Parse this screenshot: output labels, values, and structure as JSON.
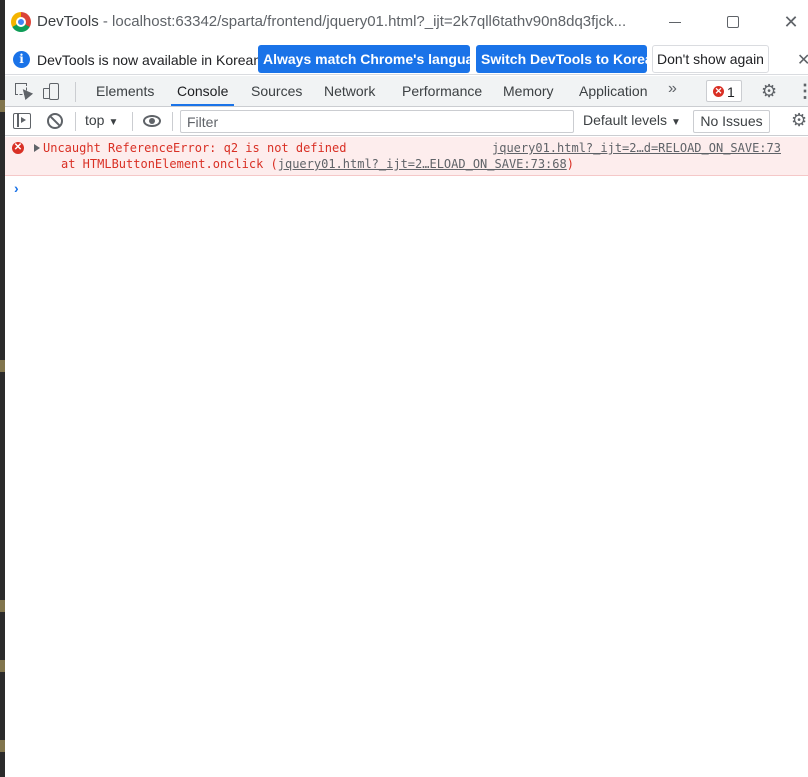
{
  "titlebar": {
    "app_name": "DevTools",
    "separator": " - ",
    "url": "localhost:63342/sparta/frontend/jquery01.html?_ijt=2k7qll6tathv90n8dq3fjck..."
  },
  "infobar": {
    "message": "DevTools is now available in Korean!",
    "match_language_label": "Always match Chrome's language",
    "switch_label": "Switch DevTools to Korean",
    "dismiss_label": "Don't show again"
  },
  "tabs": [
    {
      "label": "Elements"
    },
    {
      "label": "Console"
    },
    {
      "label": "Sources"
    },
    {
      "label": "Network"
    },
    {
      "label": "Performance"
    },
    {
      "label": "Memory"
    },
    {
      "label": "Application"
    }
  ],
  "active_tab": "Console",
  "more_tabs_glyph": "»",
  "error_count": "1",
  "console_toolbar": {
    "context": "top",
    "filter_placeholder": "Filter",
    "levels": "Default levels",
    "issues": "No Issues"
  },
  "messages": [
    {
      "level": "error",
      "text": "Uncaught ReferenceError: q2 is not defined",
      "source": "jquery01.html?_ijt=2…d=RELOAD_ON_SAVE:73",
      "stack_prefix": "at HTMLButtonElement.onclick (",
      "stack_link": "jquery01.html?_ijt=2…ELOAD_ON_SAVE:73:68",
      "stack_suffix": ")"
    }
  ],
  "prompt_glyph": "›",
  "colors": {
    "accent": "#1a73e8",
    "error": "#d93025",
    "error_bg": "#fdeded"
  }
}
